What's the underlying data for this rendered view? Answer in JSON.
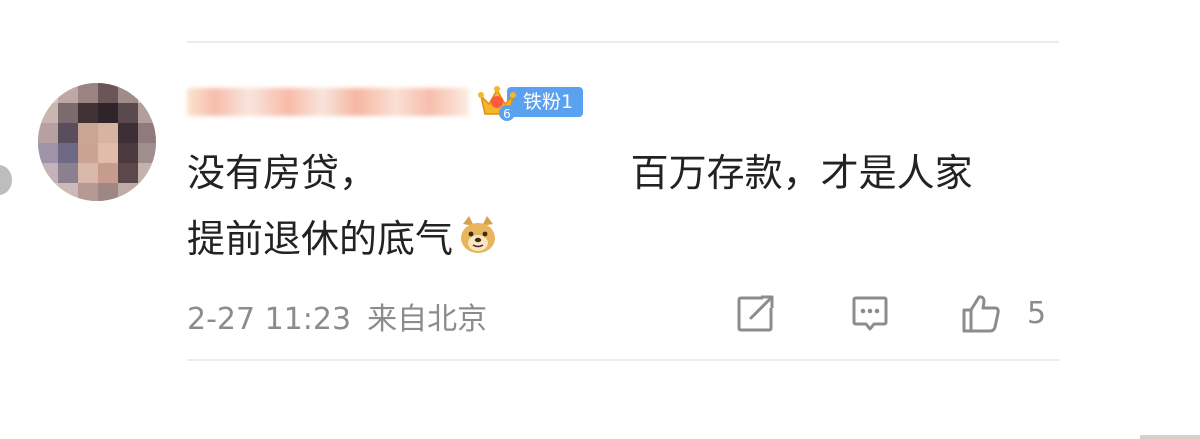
{
  "comment": {
    "badge": "铁粉1",
    "crown_level": "6",
    "text_line1": "没有房贷，                     百万存款，才是人家",
    "text_line2": "提前退休的底气",
    "emoji": "doge-emoji",
    "time": "2-27 11:23",
    "location": "来自北京",
    "like_count": "5"
  },
  "icons": {
    "share": "share-edit-icon",
    "comment": "comment-icon",
    "like": "thumbs-up-icon"
  },
  "colors": {
    "text": "#222222",
    "meta": "#8c8c8c",
    "badge": "#5aa1f0",
    "divider": "#ececec"
  }
}
